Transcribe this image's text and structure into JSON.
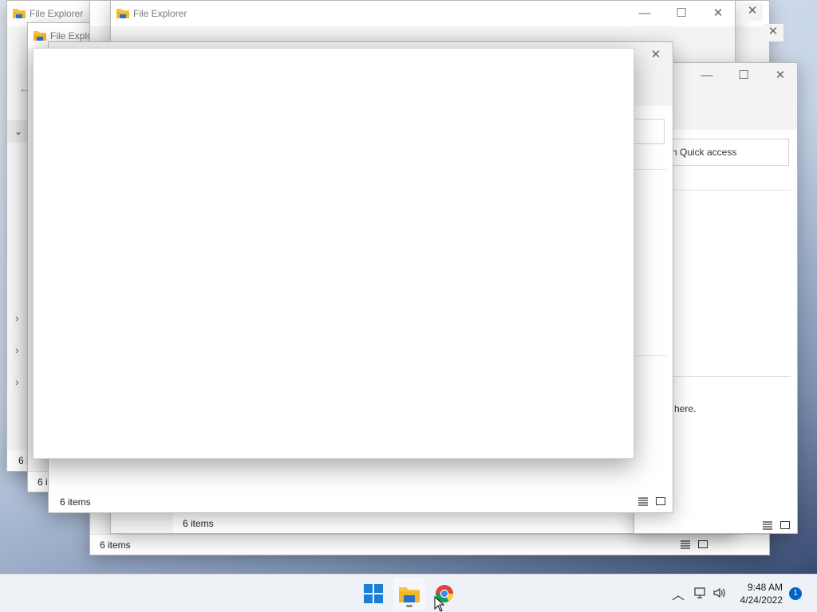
{
  "windows": [
    {
      "title": "File Explorer",
      "status": "6 items"
    },
    {
      "title": "File Explorer",
      "status": "6 items"
    },
    {
      "title": "File Explorer",
      "status": "6 items"
    },
    {
      "title": "",
      "status": "6 items"
    },
    {
      "title": "",
      "status": "6 items"
    },
    {
      "title": "",
      "status": "6 items"
    }
  ],
  "search": {
    "placeholder": "Search Quick access",
    "visible_fragment": "rch Quick access"
  },
  "empty_text_fragment": "here.",
  "taskbar": {
    "apps": [
      {
        "name": "Start",
        "icon": "windows-logo-icon"
      },
      {
        "name": "File Explorer",
        "icon": "folder-icon",
        "running": true
      },
      {
        "name": "Google Chrome",
        "icon": "chrome-icon"
      }
    ],
    "time": "9:48 AM",
    "date": "4/24/2022",
    "notification_count": "1"
  },
  "colors": {
    "accent": "#0063c6",
    "folder": "#f6c343"
  }
}
